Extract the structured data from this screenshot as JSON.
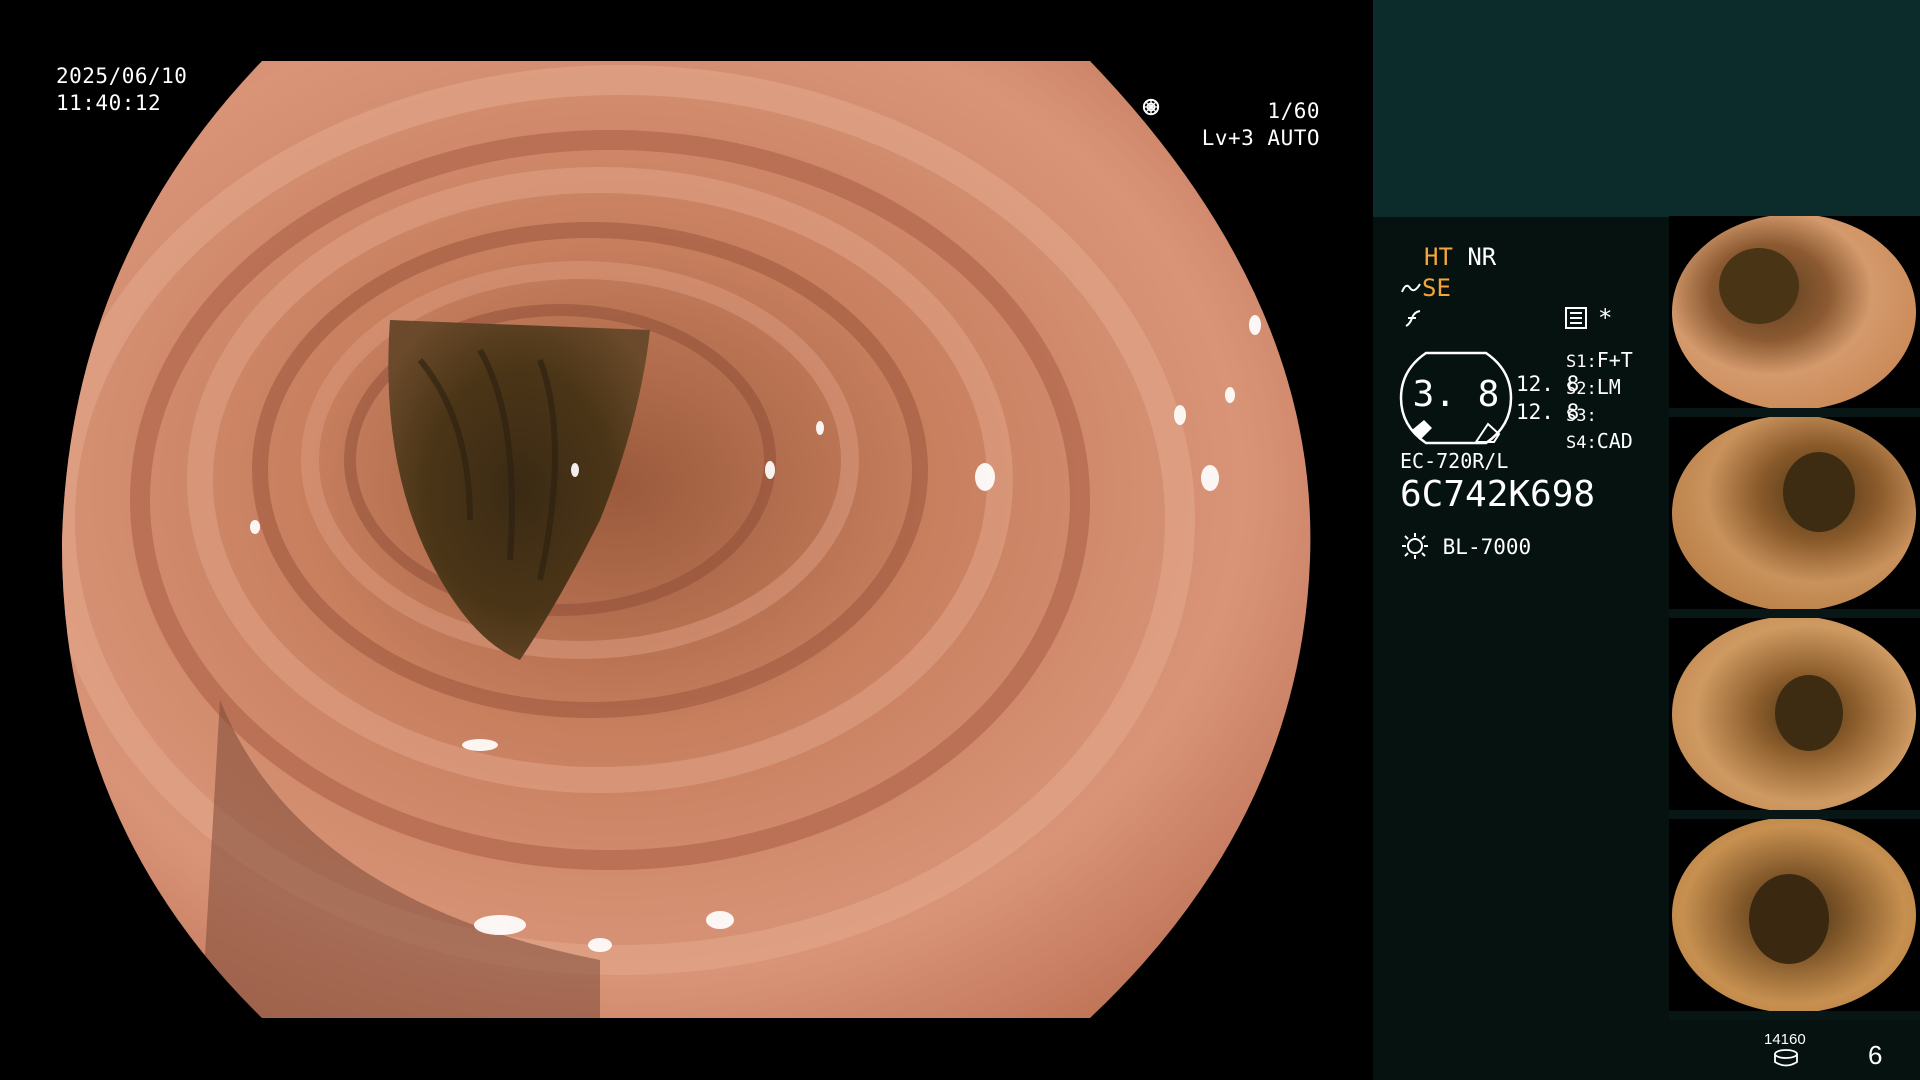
{
  "overlay": {
    "date": "2025/06/10",
    "time": "11:40:12",
    "shutter": "1/60",
    "shutter_icon": "aperture-icon",
    "level": "Lv+3",
    "mode": "AUTO",
    "mode_icon": "iris-icon"
  },
  "panel": {
    "ht": "HT",
    "nr": "NR",
    "se": "SE",
    "se_icon": "enhance-icon",
    "contrast_icon": "contrast-icon",
    "menu_icon": "settings-list-icon",
    "asterisk": "*",
    "zoom_value": "3. 8",
    "zoom_val_top": "12. 8",
    "zoom_val_bottom": "12. 8",
    "s_labels": [
      "S1:",
      "S2:",
      "S3:",
      "S4:"
    ],
    "s_values": [
      "F+T",
      "LM",
      "",
      "CAD"
    ],
    "scope_model": "EC-720R/L",
    "serial": "6C742K698",
    "light_icon": "light-source-icon",
    "light_source": "BL-7000",
    "counter_value": "14160",
    "counter_icon": "disk-icon",
    "page_number": "6"
  },
  "colors": {
    "accent_orange": "#f5a63b",
    "panel_dark": "#061210",
    "panel_top": "#0c2b2b"
  }
}
